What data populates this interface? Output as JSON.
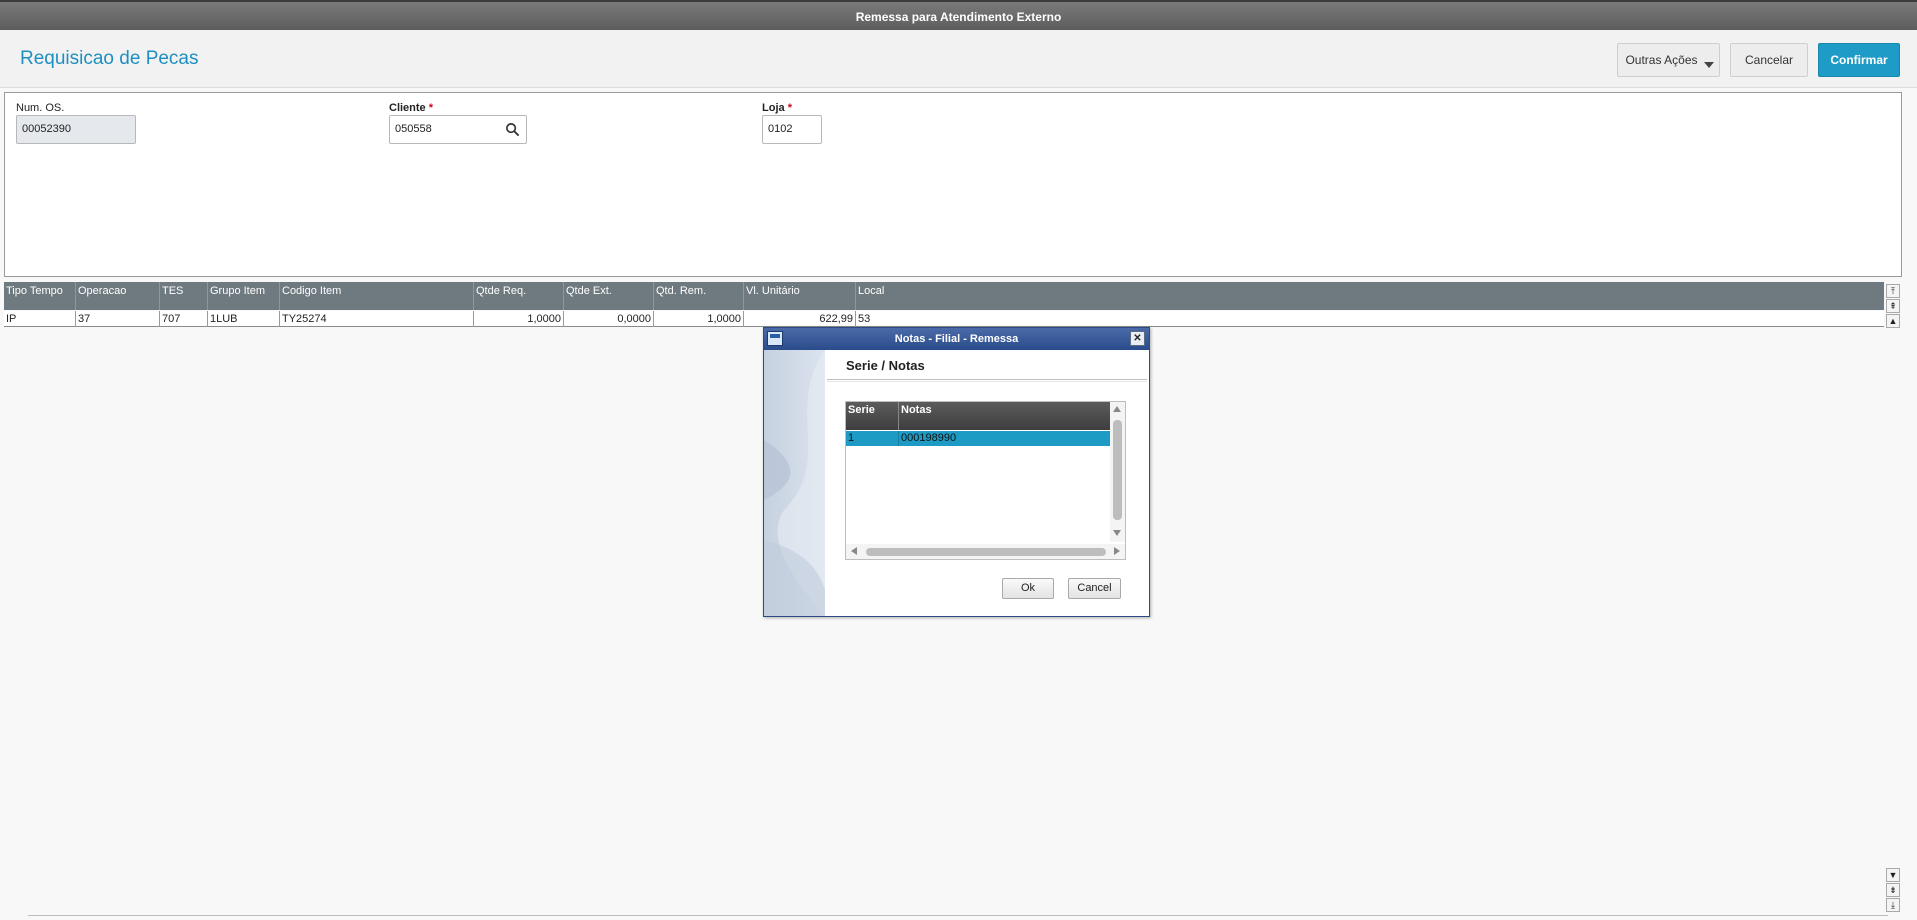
{
  "window": {
    "title": "Remessa para Atendimento Externo"
  },
  "header": {
    "page_title": "Requisicao de Pecas",
    "btn_outras": "Outras Ações",
    "btn_cancelar": "Cancelar",
    "btn_confirmar": "Confirmar"
  },
  "form": {
    "num_os": {
      "label": "Num. OS.",
      "value": "00052390"
    },
    "cliente": {
      "label": "Cliente",
      "required_mark": "*",
      "value": "050558"
    },
    "loja": {
      "label": "Loja",
      "required_mark": "*",
      "value": "0102"
    }
  },
  "grid": {
    "columns": [
      "Tipo Tempo",
      "Operacao",
      "TES",
      "Grupo Item",
      "Codigo Item",
      "Qtde Req.",
      "Qtde Ext.",
      "Qtd. Rem.",
      "Vl. Unitário",
      "Local"
    ],
    "rows": [
      [
        "IP",
        "37",
        "707",
        "1LUB",
        "TY25274",
        "1,0000",
        "0,0000",
        "1,0000",
        "622,99",
        "53"
      ]
    ]
  },
  "dialog": {
    "title": "Notas - Filial  - Remessa",
    "heading": "Serie / Notas",
    "columns": [
      "Serie",
      "Notas"
    ],
    "rows": [
      [
        "1",
        "000198990"
      ]
    ],
    "btn_ok": "Ok",
    "btn_cancel": "Cancel"
  },
  "icons": {
    "search": "search-icon",
    "close": "close-icon",
    "dropdown": "chevron-down-icon"
  },
  "colors": {
    "accent": "#1e9cc7",
    "title_blue": "#1e8fc1",
    "grid_header": "#6f7a80",
    "selected_row": "#1e9bc4"
  }
}
